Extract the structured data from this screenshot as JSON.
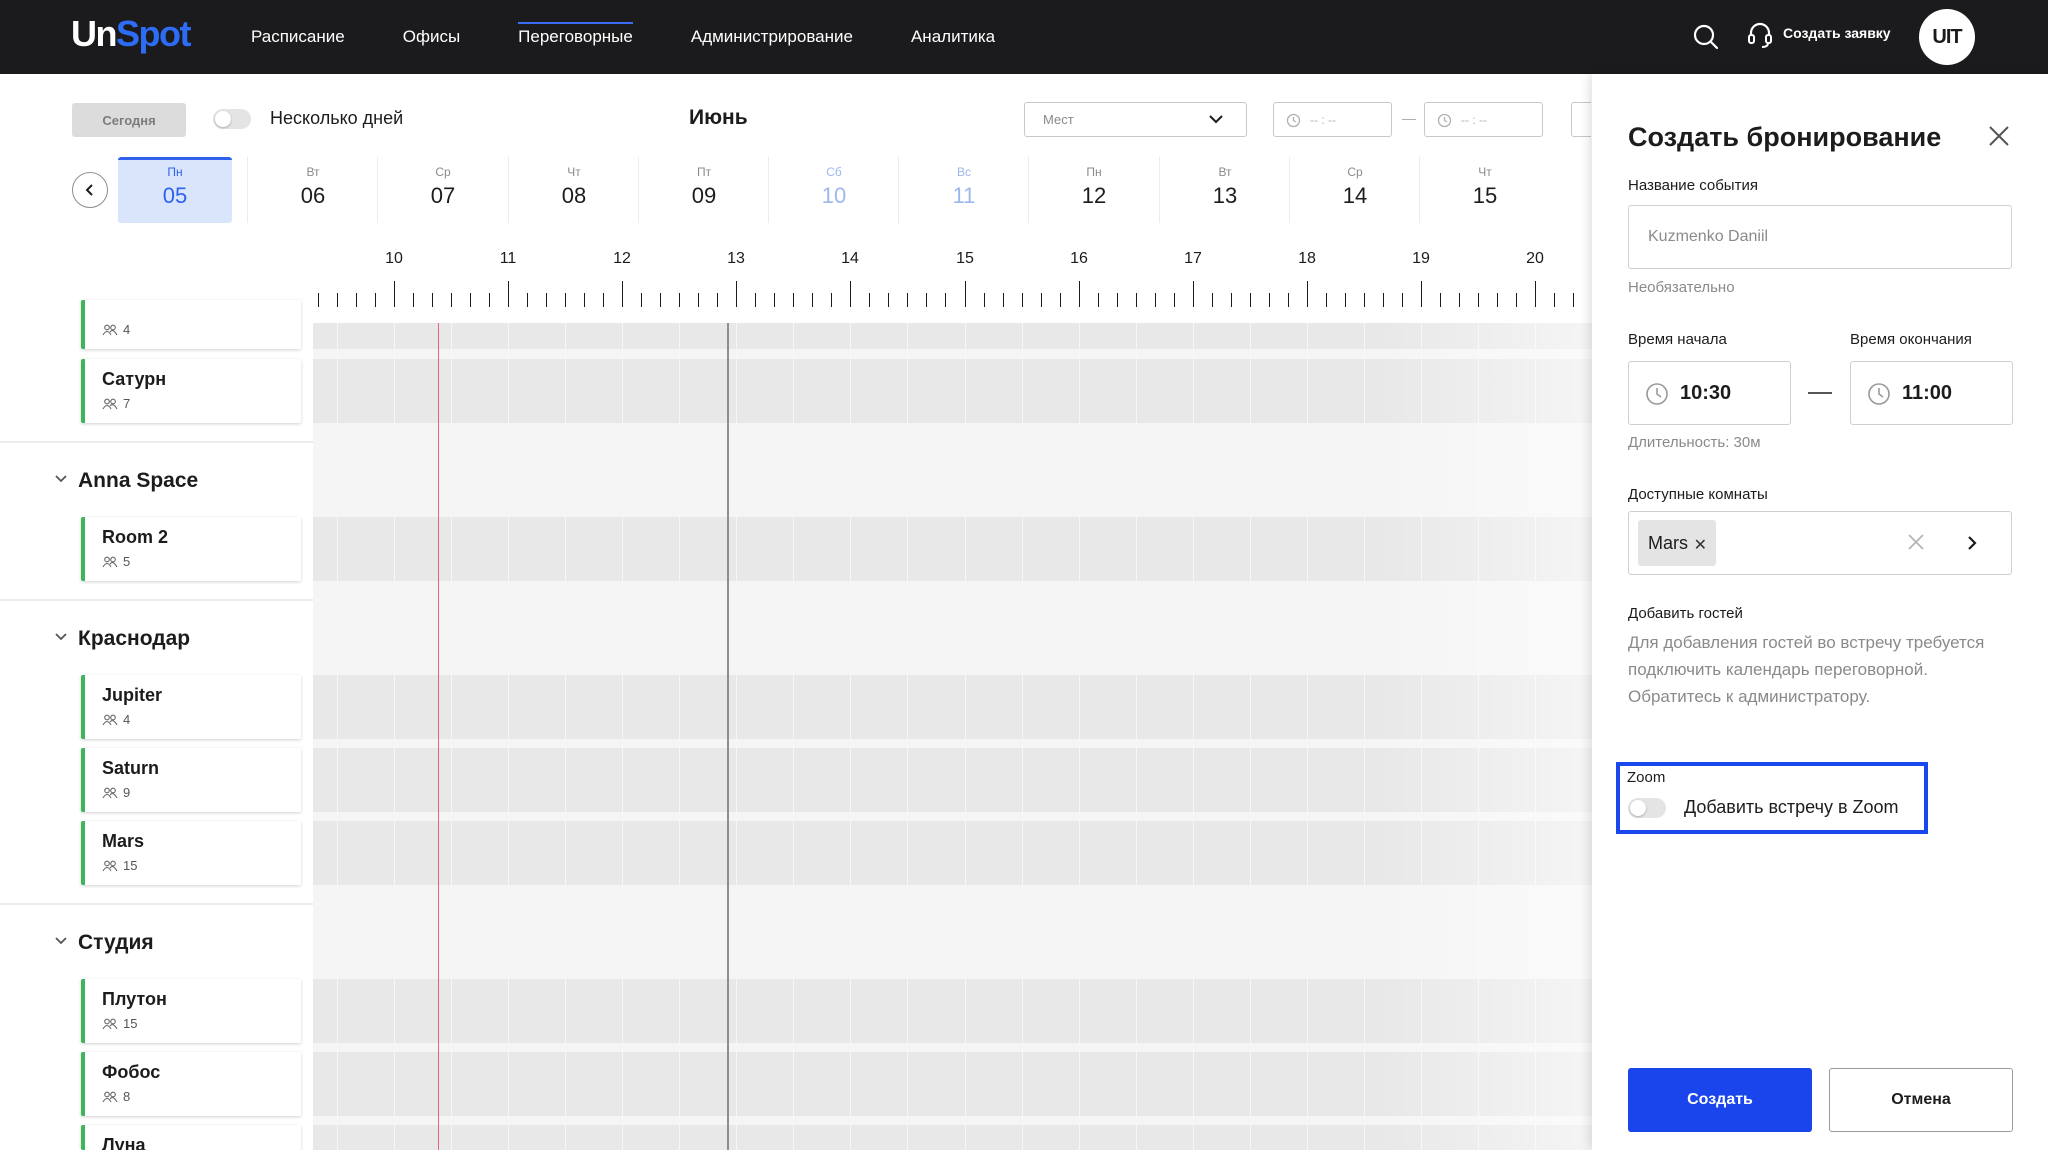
{
  "header": {
    "logo_un": "Un",
    "logo_spot": "Spot",
    "nav": [
      "Расписание",
      "Офисы",
      "Переговорные",
      "Администрирование",
      "Аналитика"
    ],
    "active_nav": "Переговорные",
    "create_request": "Создать заявку",
    "avatar_initials": "UIT"
  },
  "toolbar": {
    "today": "Сегодня",
    "multi_days": "Несколько дней",
    "month": "Июнь",
    "places_placeholder": "Мест",
    "time_from_placeholder": "-- : --",
    "time_to_placeholder": "-- : --"
  },
  "days": [
    {
      "dow": "Пн",
      "num": "05"
    },
    {
      "dow": "Вт",
      "num": "06"
    },
    {
      "dow": "Ср",
      "num": "07"
    },
    {
      "dow": "Чт",
      "num": "08"
    },
    {
      "dow": "Пт",
      "num": "09"
    },
    {
      "dow": "Сб",
      "num": "10"
    },
    {
      "dow": "Вс",
      "num": "11"
    },
    {
      "dow": "Пн",
      "num": "12"
    },
    {
      "dow": "Вт",
      "num": "13"
    },
    {
      "dow": "Ср",
      "num": "14"
    },
    {
      "dow": "Чт",
      "num": "15"
    }
  ],
  "selected_day": "05",
  "hours": [
    "10",
    "11",
    "12",
    "13",
    "14",
    "15",
    "16",
    "17",
    "18",
    "19",
    "20"
  ],
  "rooms": {
    "top_partial_capacity": "4",
    "saturn_ru": {
      "name": "Сатурн",
      "capacity": "7"
    },
    "group_anna": "Anna Space",
    "room2": {
      "name": "Room 2",
      "capacity": "5"
    },
    "group_krasnodar": "Краснодар",
    "jupiter": {
      "name": "Jupiter",
      "capacity": "4"
    },
    "saturn": {
      "name": "Saturn",
      "capacity": "9"
    },
    "mars": {
      "name": "Mars",
      "capacity": "15"
    },
    "group_studio": "Студия",
    "pluto": {
      "name": "Плутон",
      "capacity": "15"
    },
    "phobos": {
      "name": "Фобос",
      "capacity": "8"
    },
    "luna": {
      "name": "Луна"
    }
  },
  "panel": {
    "title": "Создать бронирование",
    "event_name_label": "Название события",
    "event_name_placeholder": "Kuzmenko Daniil",
    "optional": "Необязательно",
    "start_label": "Время начала",
    "end_label": "Время окончания",
    "start_value": "10:30",
    "end_value": "11:00",
    "duration": "Длительность: 30м",
    "rooms_label": "Доступные комнаты",
    "selected_room": "Mars",
    "guests_label": "Добавить гостей",
    "guests_text": "Для добавления гостей во встречу требуется подключить календарь переговорной. Обратитесь к администратору.",
    "zoom_label": "Zoom",
    "zoom_toggle_label": "Добавить встречу в Zoom",
    "create": "Создать",
    "cancel": "Отмена"
  },
  "colors": {
    "accent": "#1a45ec",
    "room_status": "#3fb55b",
    "now_line": "#e0677a",
    "topbar": "#1b1b1d"
  }
}
